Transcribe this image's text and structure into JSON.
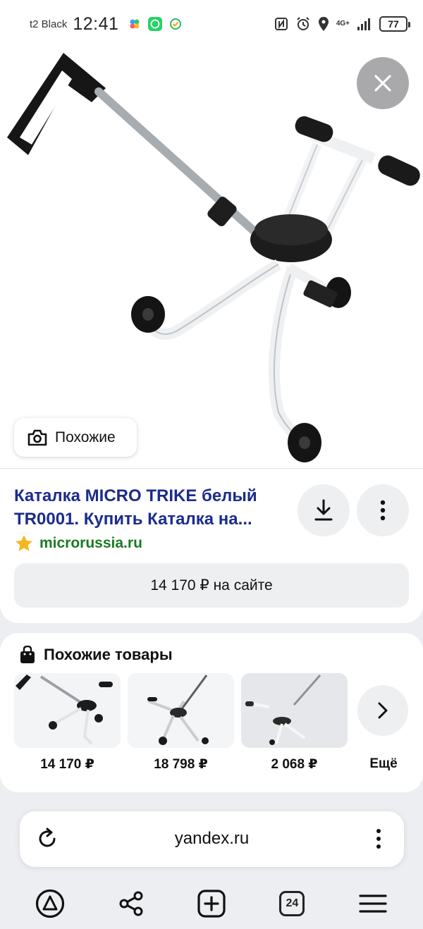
{
  "status_bar": {
    "carrier": "t2 Black",
    "time": "12:41",
    "network": "4G+",
    "battery": "77"
  },
  "viewer": {
    "similar_label": "Похожие"
  },
  "result": {
    "title": "Каталка MICRO TRIKE белый TR0001. Купить Каталка на...",
    "domain": "microrussia.ru",
    "price_button": "14 170 ₽ на сайте"
  },
  "similar_products": {
    "header": "Похожие товары",
    "items": [
      {
        "price": "14 170 ₽"
      },
      {
        "price": "18 798 ₽"
      },
      {
        "price": "2 068 ₽"
      }
    ],
    "more_label": "Ещё"
  },
  "browser": {
    "url": "yandex.ru",
    "tabs_count": "24"
  },
  "colors": {
    "title_link": "#1b2c8c",
    "domain_green": "#1a7a24"
  }
}
